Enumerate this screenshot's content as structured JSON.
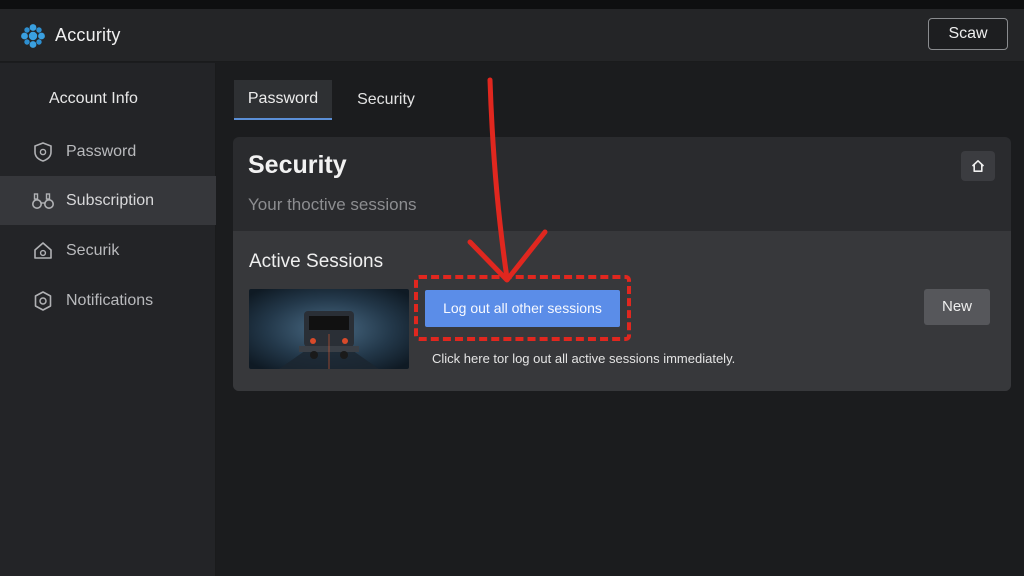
{
  "window": {
    "app_title": "Accurity",
    "save_button": "Scaw"
  },
  "sidebar": {
    "heading": "Account Info",
    "items": [
      {
        "label": "Password",
        "icon": "shield-icon",
        "active": false
      },
      {
        "label": "Subscription",
        "icon": "binoculars-icon",
        "active": true
      },
      {
        "label": "Securik",
        "icon": "home-lock-icon",
        "active": false
      },
      {
        "label": "Notifications",
        "icon": "gear-shield-icon",
        "active": false
      }
    ]
  },
  "tabs": [
    {
      "label": "Password",
      "active": true
    },
    {
      "label": "Security",
      "active": false
    }
  ],
  "card": {
    "title": "Security",
    "subtitle": "Your thoctive sessions",
    "home_icon": "home-icon"
  },
  "sessions": {
    "title": "Active Sessions",
    "logout_button": "Log out all other sessions",
    "hint": "Click here tor log out all active sessions immediately.",
    "new_button": "New"
  },
  "annotation": {
    "color": "#e0271f"
  },
  "colors": {
    "accent": "#5b8de8",
    "tab_underline": "#5b8fd6"
  }
}
